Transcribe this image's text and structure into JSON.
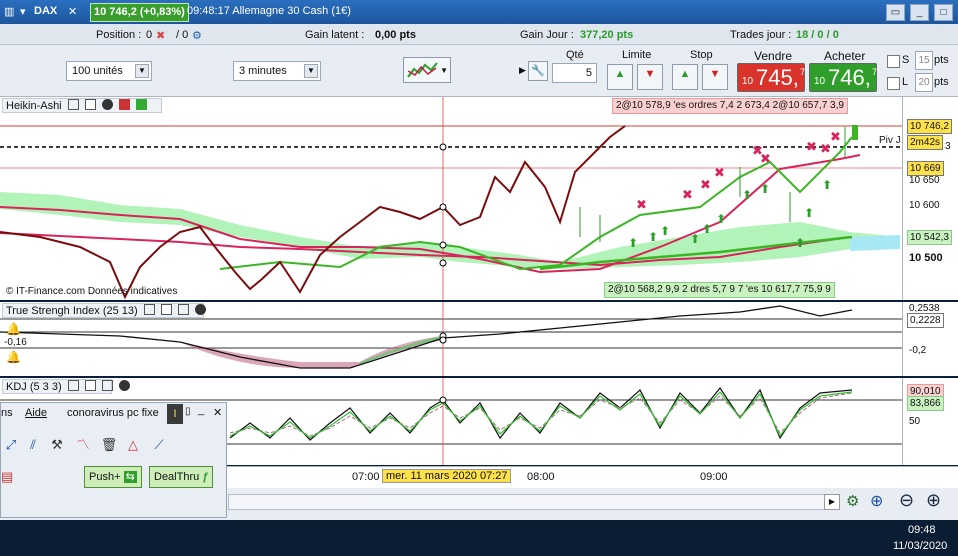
{
  "topbar": {
    "instrument": "DAX",
    "price_badge": "10 746,2 (+0,83%)",
    "time_title": "09:48:17 Allemagne 30 Cash (1€)"
  },
  "status": {
    "position_label": "Position :",
    "position_value": "0",
    "position_value2": "/ 0",
    "latent_label": "Gain latent :",
    "latent_value": "0,00 pts",
    "gain_label": "Gain Jour :",
    "gain_value": "377,20 pts",
    "trades_label": "Trades jour :",
    "trades_value": "18 / 0 / 0"
  },
  "controls": {
    "units": "100 unités",
    "period": "3 minutes",
    "qty_label": "Qté",
    "qty_value": "5",
    "limit_label": "Limite",
    "stop_label": "Stop",
    "sell_label": "Vendre",
    "buy_label": "Acheter",
    "sell_prefix": "10",
    "sell_price": "745,",
    "sell_sup": "7",
    "buy_prefix": "10",
    "buy_price": "746,",
    "buy_sup": "7",
    "s_label": "S",
    "s_value": "15",
    "s_unit": "pts",
    "l_label": "L",
    "l_value": "20",
    "l_unit": "pts"
  },
  "main_panel": {
    "title": "Heikin-Ashi",
    "order_top": "2@10 578,9 'es ordres 7,4 2  673,4 2@10 657,7 3,9",
    "order_bottom": "2@10 568,2 9,9 2 dres 5,7 9 7 'es 10 617,7 75,9 9",
    "credit": "© IT-Finance.com  Données indicatives",
    "piv_label": "Piv J",
    "axis_price1": "10 746,2",
    "axis_timer": "2m42s",
    "axis_3": "3",
    "axis_price2": "10 669",
    "axis_650": "10 650",
    "axis_600": "10 600",
    "axis_542": "10 542,3",
    "axis_500": "10 500"
  },
  "tsi_panel": {
    "title": "True Strengh Index (25 13)",
    "left_value": "-0,16",
    "axis_top": "0,2538",
    "axis_mid": "0,2228",
    "axis_low": "-0,2"
  },
  "kdj_panel": {
    "title": "KDJ (5 3 3)",
    "axis_top": "90,010",
    "axis_mid": "83,866",
    "axis_50": "50"
  },
  "time_axis": {
    "t1": "07:00",
    "cursor": "mer. 11 mars 2020 07:27",
    "t2": "08:00",
    "t3": "09:00"
  },
  "side_panel": {
    "tab1": "ns",
    "tab2": "Aide",
    "tab3": "conoravirus pc fixe",
    "push_btn": "Push+",
    "deal_btn": "DealThru"
  },
  "taskbar": {
    "time": "09:48",
    "date": "11/03/2020"
  },
  "colors": {
    "sell": "#d9332b",
    "buy": "#2f9e2a",
    "badge": "#3a9e2e",
    "ha_line": "#7a0c10",
    "ma_red": "#d8245a",
    "ma_green": "#3cb524"
  }
}
